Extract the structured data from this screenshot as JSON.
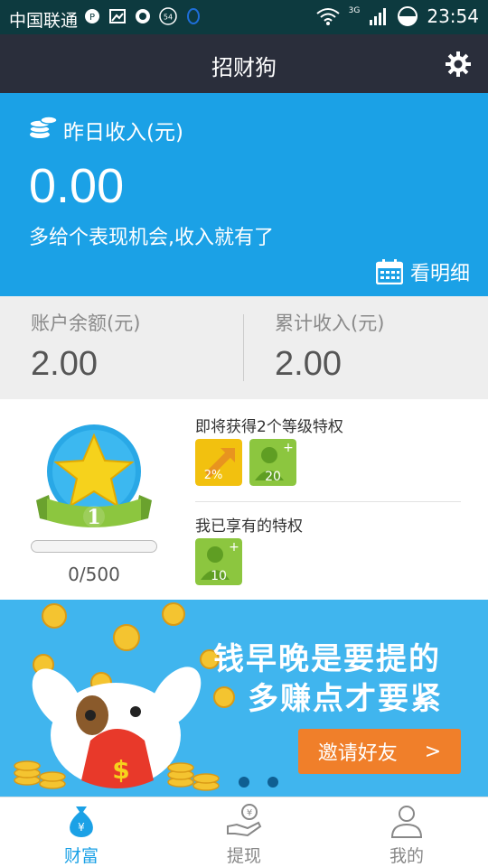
{
  "status_bar": {
    "carrier": "中国联通",
    "time": "23:54",
    "network": "3G",
    "icons": [
      "notification-icon",
      "image-icon",
      "browser-icon",
      "badge-icon",
      "qq-icon",
      "wifi-icon",
      "signal-icon",
      "battery-icon"
    ],
    "badge_number": "54"
  },
  "title_bar": {
    "title": "招财狗",
    "settings_icon": "gear-icon"
  },
  "income": {
    "label": "昨日收入(元)",
    "amount": "0.00",
    "hint": "多给个表现机会,收入就有了",
    "detail_label": "看明细",
    "detail_icon": "calendar-icon",
    "header_icon": "coins-icon"
  },
  "balances": [
    {
      "label": "账户余额(元)",
      "value": "2.00"
    },
    {
      "label": "累计收入(元)",
      "value": "2.00"
    }
  ],
  "level": {
    "rank": "1",
    "progress_text": "0/500",
    "progress_fraction": 0.0,
    "upcoming_title": "即将获得2个等级特权",
    "upcoming_perks": [
      {
        "icon": "percent-arrow-icon",
        "text": "2%",
        "color": "#f2c10f"
      },
      {
        "icon": "user-plus-icon",
        "text": "20",
        "color": "#8cc63f"
      }
    ],
    "owned_title": "我已享有的特权",
    "owned_perks": [
      {
        "icon": "user-plus-icon",
        "text": "10",
        "color": "#8cc63f"
      }
    ]
  },
  "banner": {
    "line1": "钱早晚是要提的",
    "line2": "多赚点才要紧",
    "button_label": "邀请好友",
    "button_arrow": ">",
    "page_count": 2
  },
  "bottom_nav": [
    {
      "label": "财富",
      "icon": "money-bag-icon",
      "active": true
    },
    {
      "label": "提现",
      "icon": "hand-yen-icon",
      "active": false
    },
    {
      "label": "我的",
      "icon": "person-icon",
      "active": false
    }
  ],
  "colors": {
    "primary": "#1ba1e6",
    "title_bar": "#2a2e3b",
    "accent_orange": "#f07f2a",
    "nav_active": "#1ba1e6",
    "nav_inactive": "#888888"
  }
}
